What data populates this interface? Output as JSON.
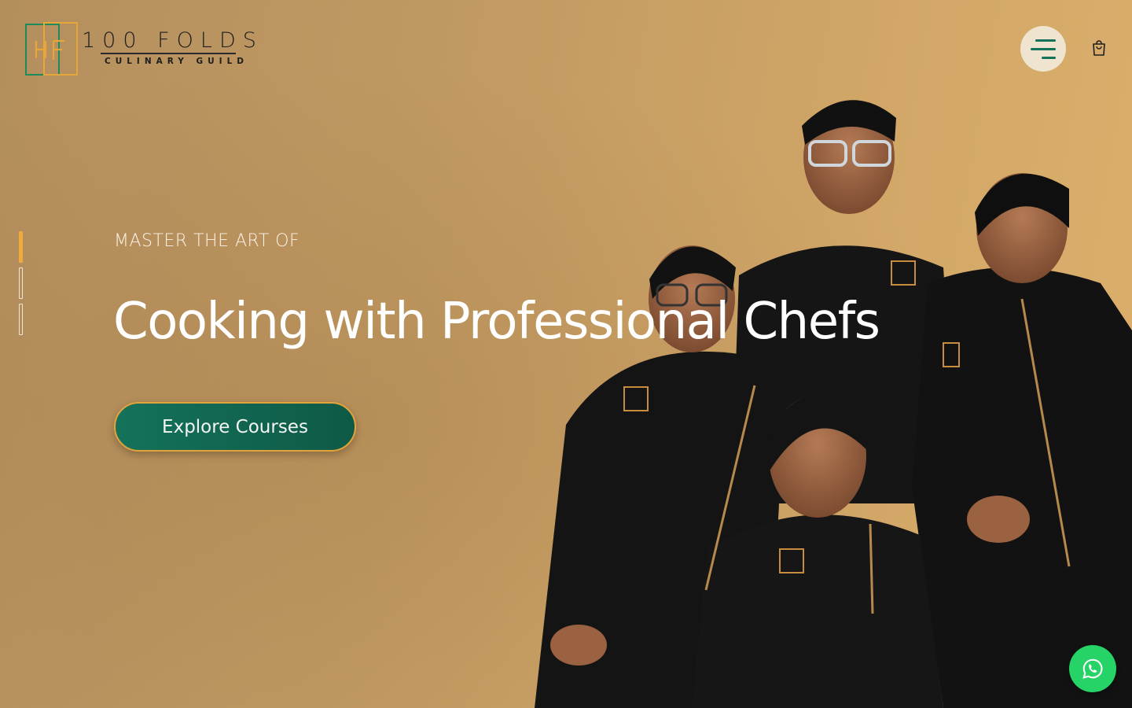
{
  "brand": {
    "mark_letters": "HF",
    "name": "100 FOLDS",
    "subtitle": "CULINARY GUILD",
    "mark_colors": {
      "green": "#1f8a5a",
      "gold": "#e7a63a"
    }
  },
  "header": {
    "menu_icon": "hamburger-menu-icon",
    "cart_icon": "shopping-bag-icon"
  },
  "hero": {
    "eyebrow": "MASTER THE ART OF",
    "headline": "Cooking with Professional Chefs",
    "cta_label": "Explore Courses",
    "slides_total": 3,
    "active_slide": 1
  },
  "colors": {
    "accent_green": "#14725a",
    "accent_gold": "#e2a33b",
    "background": "#c29a62",
    "whatsapp": "#25d366"
  },
  "floating": {
    "whatsapp_icon": "whatsapp-icon"
  }
}
